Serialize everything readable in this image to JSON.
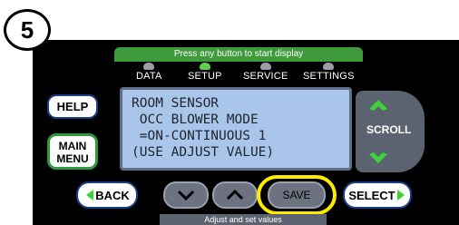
{
  "step_number": "5",
  "banner_text": "Press any button to start display",
  "modes": [
    {
      "label": "DATA",
      "active": false
    },
    {
      "label": "SETUP",
      "active": true
    },
    {
      "label": "SERVICE",
      "active": false
    },
    {
      "label": "SETTINGS",
      "active": false
    }
  ],
  "lcd": {
    "line1": "ROOM SENSOR",
    "line2": " OCC BLOWER MODE",
    "line3": " =ON-CONTINUOUS 1",
    "line4": "(USE ADJUST VALUE)"
  },
  "buttons": {
    "help": "HELP",
    "main_menu_line1": "MAIN",
    "main_menu_line2": "MENU",
    "scroll": "SCROLL",
    "back": "BACK",
    "save": "SAVE",
    "select": "SELECT"
  },
  "caption": "Adjust and set values",
  "colors": {
    "panel": "#000000",
    "banner": "#3e9a3a",
    "lcd": "#a9c6ea",
    "highlight_ring": "#ffeb00",
    "arrow_green": "#3fd13a"
  },
  "icons": {
    "scroll_up": "chevron-up-icon",
    "scroll_down": "chevron-down-icon",
    "adjust_down": "chevron-down-icon",
    "adjust_up": "chevron-up-icon",
    "back": "triangle-left-icon",
    "select": "triangle-right-icon"
  }
}
